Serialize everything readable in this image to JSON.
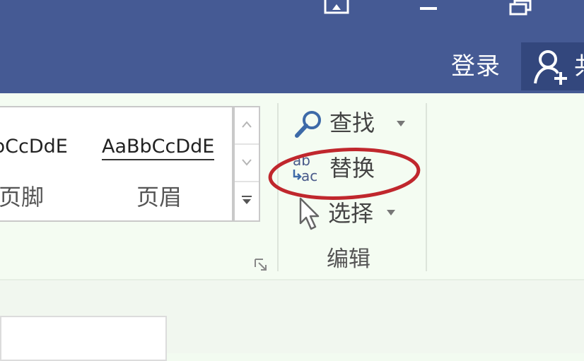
{
  "titlebar": {
    "login_label": "登录",
    "share_label_partial": "共",
    "colors": {
      "background": "#455a94",
      "share_bg": "#33477d"
    }
  },
  "window_controls": [
    "restore-icon",
    "minimize-icon",
    "maximize-icon"
  ],
  "styles_gallery": {
    "items": [
      {
        "sample": "bCcDdE",
        "name": "页脚"
      },
      {
        "sample": "AaBbCcDdE",
        "name": "页眉"
      }
    ],
    "scroll_buttons": [
      "scroll-up",
      "scroll-down",
      "more"
    ]
  },
  "editing_group": {
    "label": "编辑",
    "commands": [
      {
        "id": "find",
        "label": "查找",
        "icon": "search-icon",
        "has_dropdown": true
      },
      {
        "id": "replace",
        "label": "替换",
        "icon": "replace-abac-icon",
        "has_dropdown": false
      },
      {
        "id": "select",
        "label": "选择",
        "icon": "cursor-arrow-icon",
        "has_dropdown": true
      }
    ]
  },
  "annotation": {
    "shape": "ellipse",
    "color": "#c0272d",
    "target": "replace"
  },
  "ribbon_background": "#f4fcf2"
}
